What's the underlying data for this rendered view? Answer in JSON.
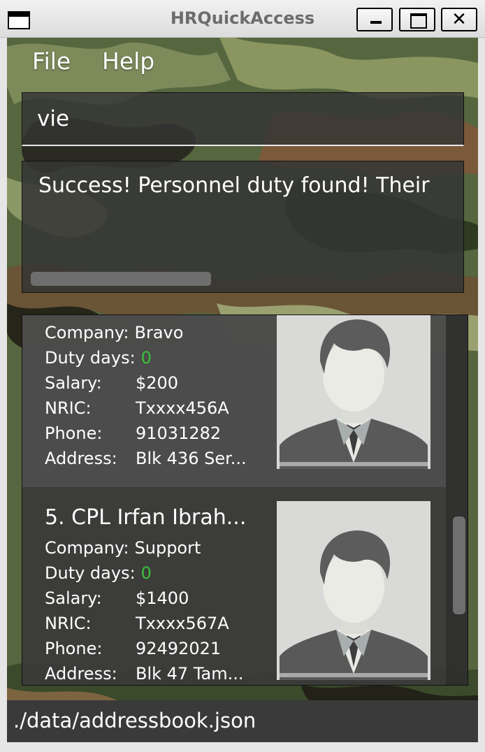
{
  "window": {
    "title": "HRQuickAccess"
  },
  "menu": {
    "file_label": "File",
    "help_label": "Help"
  },
  "command": {
    "value": "vie"
  },
  "result": {
    "message": "Success! Personnel duty found! Their"
  },
  "persons": [
    {
      "name": "",
      "company": "Bravo",
      "duty_days": "0",
      "salary": "$200",
      "nric": "Txxxx456A",
      "phone": "91031282",
      "address": "Blk 436 Ser..."
    },
    {
      "name": "5. CPL Irfan Ibrah...",
      "company": "Support",
      "duty_days": "0",
      "salary": "$1400",
      "nric": "Txxxx567A",
      "phone": "92492021",
      "address": "Blk 47 Tam..."
    }
  ],
  "labels": {
    "company": "Company:",
    "duty_days": "Duty days:",
    "salary": "Salary:",
    "nric": "NRIC:",
    "phone": "Phone:",
    "address": "Address:"
  },
  "status_bar": {
    "path": "./data/addressbook.json"
  },
  "colors": {
    "duty_days_value": "#3cbf3c",
    "panel_bg": "#3a3a3a",
    "camo_green": "#4a5a3a"
  },
  "icons": {
    "window": "window-icon",
    "minimize": "minimize-icon",
    "maximize": "maximize-icon",
    "close": "close-icon",
    "profile_photo": "profile-placeholder-icon"
  }
}
